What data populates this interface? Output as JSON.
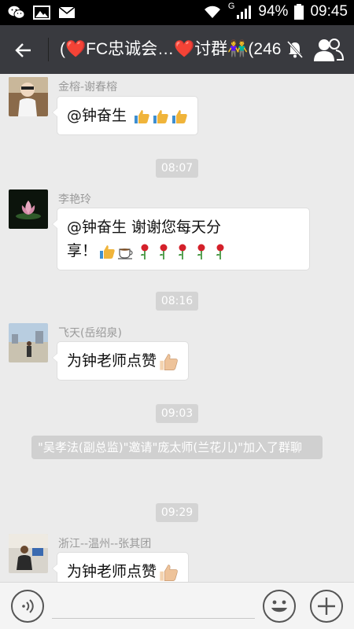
{
  "status_bar": {
    "network_type": "G",
    "battery": "94%",
    "time": "09:45",
    "left_icons": [
      "wechat-icon",
      "image-icon",
      "mail-icon"
    ]
  },
  "app_bar": {
    "title": "(❤️FC忠诚会…❤️讨群👫(246",
    "icons": [
      "back-arrow-icon",
      "mute-bell-icon",
      "group-members-icon"
    ],
    "colors": {
      "background": "#393a3f",
      "text": "#ffffff"
    }
  },
  "chat": {
    "colors": {
      "background": "#ebebeb",
      "bubble": "#ffffff",
      "timestamp_bg": "#d4d4d4",
      "system_bg": "#d0d0d0",
      "sender": "#9a9a9a"
    },
    "items": [
      {
        "type": "message",
        "sender": "金榕-谢春榕",
        "text": "@钟奋生 ",
        "emoji": [
          "thumbs-up",
          "thumbs-up",
          "thumbs-up"
        ]
      },
      {
        "type": "timestamp",
        "text": "08:07"
      },
      {
        "type": "message",
        "sender": "李艳玲",
        "text_line1": "@钟奋生 谢谢您每天分",
        "text_line2": "享！",
        "emoji": [
          "thumbs-up",
          "coffee",
          "rose",
          "rose",
          "rose",
          "rose",
          "rose"
        ]
      },
      {
        "type": "timestamp",
        "text": "08:16"
      },
      {
        "type": "message",
        "sender": "飞天(岳绍泉)",
        "text": "为钟老师点赞",
        "emoji": [
          "thumbs-up"
        ]
      },
      {
        "type": "timestamp",
        "text": "09:03"
      },
      {
        "type": "system",
        "text": "\"吴孝法(副总监)\"邀请\"庞太师(兰花儿)\"加入了群聊"
      },
      {
        "type": "timestamp",
        "text": "09:29"
      },
      {
        "type": "message",
        "sender": "浙江--温州--张其团",
        "text": "为钟老师点赞",
        "emoji": [
          "thumbs-up"
        ]
      }
    ]
  },
  "input_bar": {
    "placeholder": "",
    "icons": [
      "voice-icon",
      "emoji-face-icon",
      "plus-icon"
    ]
  }
}
